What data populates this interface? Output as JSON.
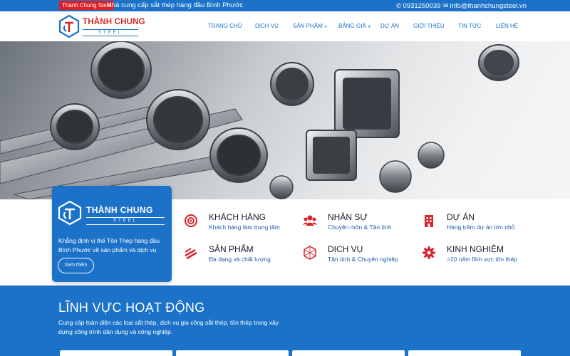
{
  "topbar": {
    "badge": "Thành Chung Steel",
    "tagline": "Nhà cung cấp sắt thép hàng đầu Bình Phước",
    "phone": "0931250039",
    "email": "info@thanhchungsteel.vn",
    "phone_icon": "phone-icon",
    "email_icon": "envelope-icon"
  },
  "logo": {
    "name": "THÀNH CHUNG",
    "sub": "STEEL"
  },
  "nav": {
    "items": [
      {
        "label": "TRANG CHỦ"
      },
      {
        "label": "DỊCH VỤ"
      },
      {
        "label": "SẢN PHẨM",
        "has_dropdown": true
      },
      {
        "label": "BẢNG GIÁ",
        "has_dropdown": true
      },
      {
        "label": "DỰ ÁN"
      },
      {
        "label": "GIỚI THIỆU"
      },
      {
        "label": "TIN TỨC"
      },
      {
        "label": "LIÊN HỆ"
      }
    ]
  },
  "company_card": {
    "name": "THÀNH CHUNG",
    "sub": "STEEL",
    "description": "Khẳng định vị thế Tôn Thép hàng đầu Bình Phước về sản phẩm và dịch vụ",
    "button": "Xem thêm"
  },
  "features": [
    {
      "title": "KHÁCH HÀNG",
      "desc": "Khách hàng làm trung tâm",
      "icon": "target-icon"
    },
    {
      "title": "NHÂN SỰ",
      "desc": "Chuyên môn & Tận tình",
      "icon": "users-icon"
    },
    {
      "title": "DỰ ÁN",
      "desc": "Hàng trăm dự án lớn nhỏ",
      "icon": "building-icon"
    },
    {
      "title": "SẢN PHẨM",
      "desc": "Đa dạng và chất lượng",
      "icon": "steel-bars-icon"
    },
    {
      "title": "DỊCH VỤ",
      "desc": "Tận tình & Chuyên nghiệp",
      "icon": "hexagon-icon"
    },
    {
      "title": "KINH NGHIỆM",
      "desc": ">20 năm lĩnh vực tôn thép",
      "icon": "gear-icon"
    }
  ],
  "section": {
    "title": "LĨNH VỰC HOẠT ĐỘNG",
    "description": "Cung cấp toàn diện các loại sắt thép, dịch vụ gia công sắt thép, tôn thép trong xây dựng công trình dân dụng và công nghiệp."
  },
  "colors": {
    "brand_blue": "#1b72c8",
    "brand_red": "#d8232a"
  }
}
